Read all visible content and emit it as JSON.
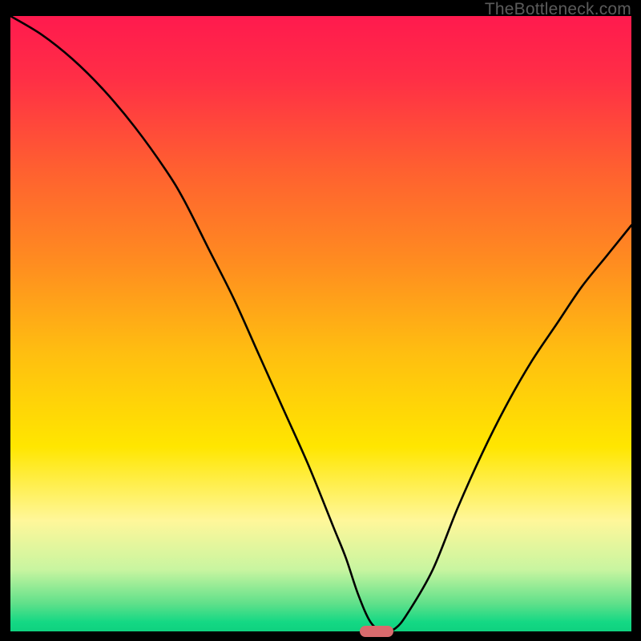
{
  "watermark": "TheBottleneck.com",
  "colors": {
    "frame": "#000000",
    "gradient_stops": [
      {
        "offset": 0.0,
        "color": "#ff1a4e"
      },
      {
        "offset": 0.1,
        "color": "#ff2e46"
      },
      {
        "offset": 0.25,
        "color": "#ff6030"
      },
      {
        "offset": 0.4,
        "color": "#ff8c20"
      },
      {
        "offset": 0.55,
        "color": "#ffbf10"
      },
      {
        "offset": 0.7,
        "color": "#ffe600"
      },
      {
        "offset": 0.82,
        "color": "#fff79a"
      },
      {
        "offset": 0.9,
        "color": "#c8f5a0"
      },
      {
        "offset": 0.955,
        "color": "#5fe08a"
      },
      {
        "offset": 0.985,
        "color": "#14d884"
      },
      {
        "offset": 1.0,
        "color": "#0fd17f"
      }
    ],
    "curve": "#000000",
    "marker": "#d96a6d"
  },
  "chart_data": {
    "type": "line",
    "title": "",
    "xlabel": "",
    "ylabel": "",
    "xlim": [
      0,
      100
    ],
    "ylim": [
      0,
      100
    ],
    "legend": false,
    "grid": false,
    "series": [
      {
        "name": "bottleneck-curve",
        "x": [
          0,
          5,
          10,
          15,
          20,
          25,
          28,
          32,
          36,
          40,
          44,
          48,
          52,
          54,
          56,
          58,
          60,
          62,
          64,
          68,
          72,
          76,
          80,
          84,
          88,
          92,
          96,
          100
        ],
        "values": [
          100,
          97,
          93,
          88,
          82,
          75,
          70,
          62,
          54,
          45,
          36,
          27,
          17,
          12,
          6,
          1.5,
          0,
          0.5,
          3,
          10,
          20,
          29,
          37,
          44,
          50,
          56,
          61,
          66
        ]
      }
    ],
    "marker": {
      "x": 59,
      "y": 0,
      "width": 5.4,
      "height": 1.8
    }
  }
}
